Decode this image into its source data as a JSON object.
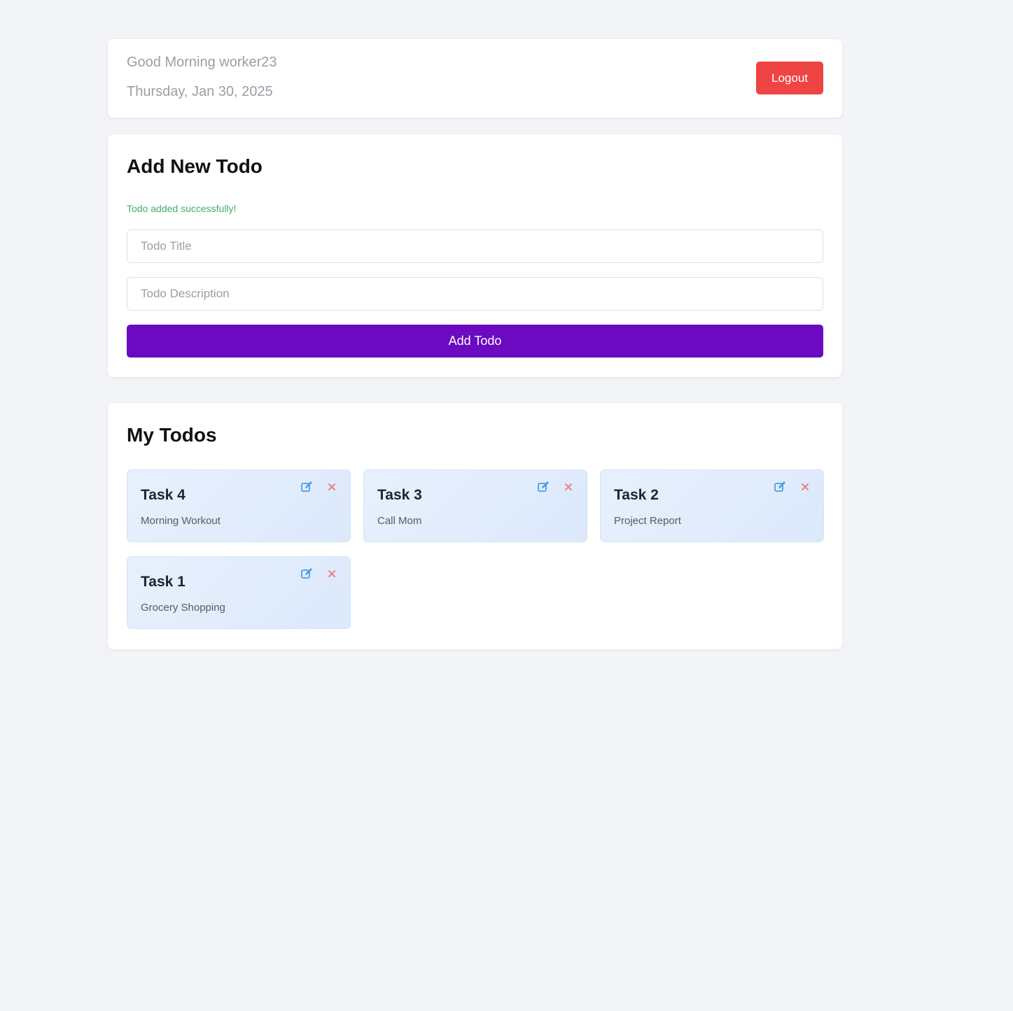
{
  "header": {
    "greeting": "Good Morning worker23",
    "date": "Thursday, Jan 30, 2025",
    "logout_label": "Logout"
  },
  "add_todo": {
    "title": "Add New Todo",
    "success_message": "Todo added successfully!",
    "title_placeholder": "Todo Title",
    "description_placeholder": "Todo Description",
    "title_value": "",
    "description_value": "",
    "button_label": "Add Todo"
  },
  "todos": {
    "title": "My Todos",
    "items": [
      {
        "title": "Task 4",
        "description": "Morning Workout"
      },
      {
        "title": "Task 3",
        "description": "Call Mom"
      },
      {
        "title": "Task 2",
        "description": "Project Report"
      },
      {
        "title": "Task 1",
        "description": "Grocery Shopping"
      }
    ]
  },
  "icons": {
    "edit": "edit-icon",
    "delete": "close-icon"
  },
  "colors": {
    "background": "#f2f4f7",
    "logout": "#ef4444",
    "primary": "#6b0ac0",
    "success": "#3fae6a",
    "edit_icon": "#4a9ee0",
    "delete_icon": "#f07f7f",
    "todo_card": "#e7f0fd"
  }
}
